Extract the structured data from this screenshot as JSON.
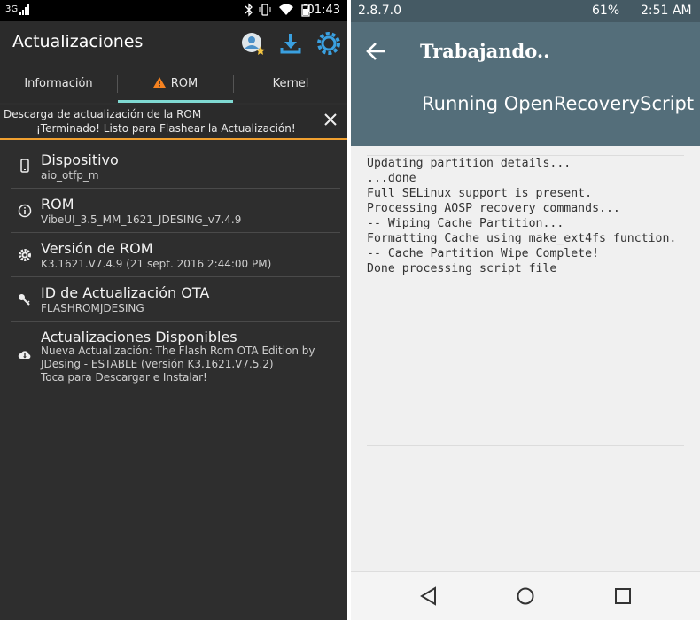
{
  "left": {
    "status": {
      "network": "3G",
      "time": "01:43"
    },
    "app_title": "Actualizaciones",
    "actions": [
      "account-star-icon",
      "download-icon",
      "settings-icon"
    ],
    "tabs": [
      {
        "label": "Información",
        "selected": false
      },
      {
        "label": "ROM",
        "selected": true,
        "icon": "warning-icon"
      },
      {
        "label": "Kernel",
        "selected": false
      }
    ],
    "banner": {
      "line1": "Descarga de actualización de la ROM",
      "line2": "¡Terminado! Listo para Flashear la Actualización!",
      "close_icon": "close-icon"
    },
    "items": [
      {
        "icon": "phone-icon",
        "title": "Dispositivo",
        "subtitle": [
          "aio_otfp_m"
        ]
      },
      {
        "icon": "info-icon",
        "title": "ROM",
        "subtitle": [
          "VibeUI_3.5_MM_1621_JDESING_v7.4.9"
        ]
      },
      {
        "icon": "gear-icon",
        "title": "Versión de ROM",
        "subtitle": [
          "K3.1621.V7.4.9 (21 sept. 2016 2:44:00 PM)"
        ]
      },
      {
        "icon": "key-icon",
        "title": "ID de Actualización OTA",
        "subtitle": [
          "FLASHROMJDESING"
        ]
      },
      {
        "icon": "cloud-download-icon",
        "title": "Actualizaciones Disponibles",
        "subtitle": [
          "Nueva Actualización: The Flash Rom OTA Edition by",
          "JDesing - ESTABLE (versión K3.1621.V7.5.2)",
          "Toca para Descargar e Instalar!"
        ]
      }
    ],
    "colors": {
      "background": "#2e2e2e",
      "tab_indicator": "#7fd9d2",
      "banner_border": "#f0a030",
      "warning": "#f58220"
    }
  },
  "right": {
    "status": {
      "version": "2.8.7.0",
      "battery": "61%",
      "time": "2:51 AM"
    },
    "title": "Trabajando..",
    "subtitle": "Running OpenRecoveryScript",
    "log": [
      "Updating partition details...",
      "...done",
      "Full SELinux support is present.",
      "Processing AOSP recovery commands...",
      "-- Wiping Cache Partition...",
      "Formatting Cache using make_ext4fs function.",
      "-- Cache Partition Wipe Complete!",
      "Done processing script file"
    ],
    "nav": [
      "back-icon",
      "home-icon",
      "recents-icon"
    ],
    "colors": {
      "status_bar": "#455a64",
      "header": "#546e7a"
    }
  }
}
